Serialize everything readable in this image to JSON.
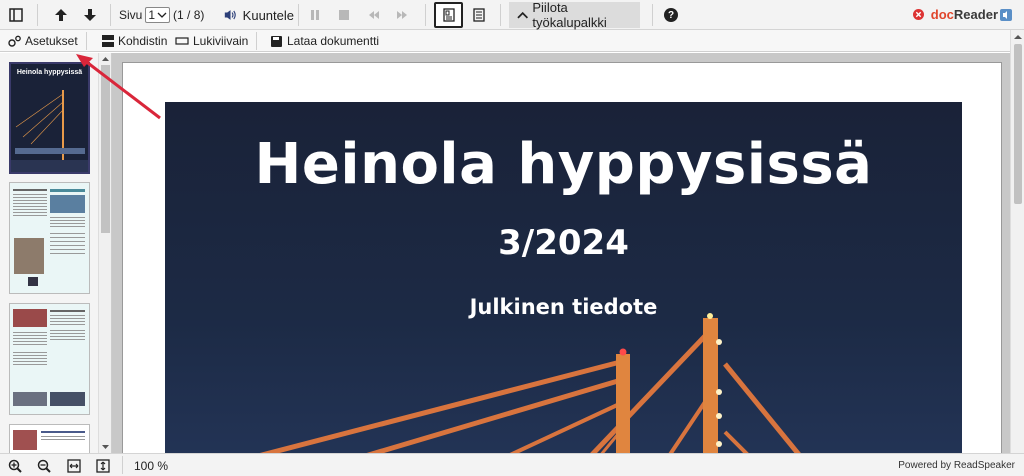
{
  "toolbar": {
    "page_label": "Sivu",
    "page_current": "1",
    "page_count": "(1 / 8)",
    "listen_label": "Kuuntele",
    "hide_toolbar_label": "Piilota työkalupalkki",
    "help_glyph": "?",
    "logo": {
      "doc": "doc",
      "reader": "Reader"
    },
    "icons": [
      "sidebar-toggle-icon",
      "arrow-up-icon",
      "arrow-down-icon",
      "speaker-icon",
      "pause-icon",
      "stop-icon",
      "rewind-icon",
      "fast-forward-icon",
      "page-view-icon",
      "text-view-icon",
      "chevron-up-icon",
      "help-icon",
      "close-icon",
      "readspeaker-icon"
    ]
  },
  "toolbar2": {
    "settings_label": "Asetukset",
    "focus_label": "Kohdistin",
    "reading_ruler_label": "Lukiviivain",
    "download_label": "Lataa dokumentti"
  },
  "thumbnails": [
    {
      "title": "Heinola hyppysissä"
    },
    {
      "title": ""
    },
    {
      "title": ""
    },
    {
      "title": ""
    }
  ],
  "document": {
    "title": "Heinola hyppysissä",
    "issue": "3/2024",
    "note": "Julkinen tiedote"
  },
  "bottom": {
    "zoom": "100 %",
    "powered_by": "Powered by ReadSpeaker"
  },
  "colors": {
    "brand_doc": "#e0452b",
    "brand_reader": "#3a3a3a",
    "annotation_arrow": "#d9263a",
    "cover_bg": "#1c2a45"
  }
}
